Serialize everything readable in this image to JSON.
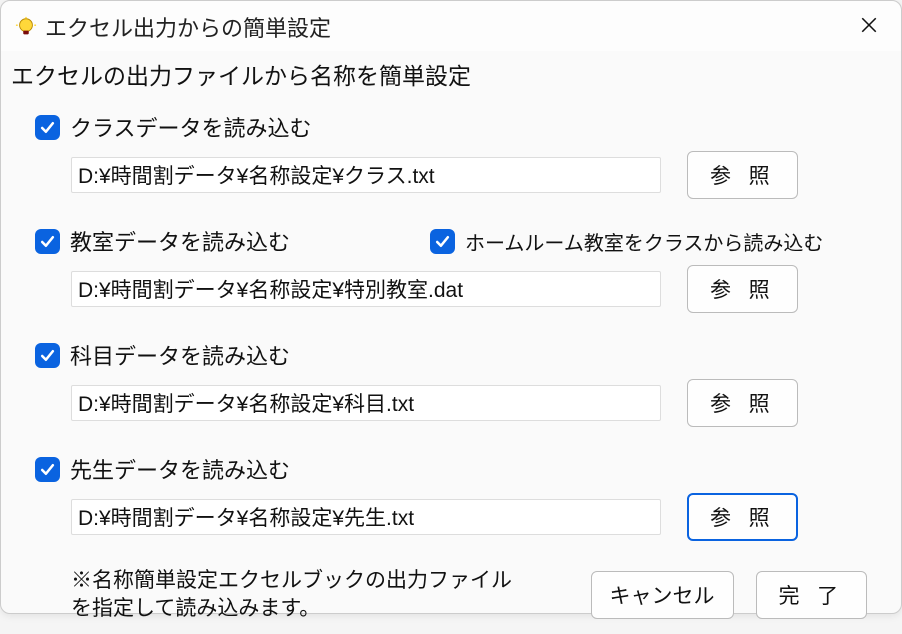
{
  "window": {
    "title": "エクセル出力からの簡単設定",
    "subtitle": "エクセルの出力ファイルから名称を簡単設定"
  },
  "sections": {
    "class": {
      "label": "クラスデータを読み込む",
      "path": "D:¥時間割データ¥名称設定¥クラス.txt",
      "browse": "参 照"
    },
    "room": {
      "label": "教室データを読み込む",
      "sub_label": "ホームルーム教室をクラスから読み込む",
      "path": "D:¥時間割データ¥名称設定¥特別教室.dat",
      "browse": "参 照"
    },
    "subject": {
      "label": "科目データを読み込む",
      "path": "D:¥時間割データ¥名称設定¥科目.txt",
      "browse": "参 照"
    },
    "teacher": {
      "label": "先生データを読み込む",
      "path": "D:¥時間割データ¥名称設定¥先生.txt",
      "browse": "参 照"
    }
  },
  "footer": {
    "note": "※名称簡単設定エクセルブックの出力ファイルを指定して読み込みます。",
    "cancel": "キャンセル",
    "complete": "完 了"
  }
}
